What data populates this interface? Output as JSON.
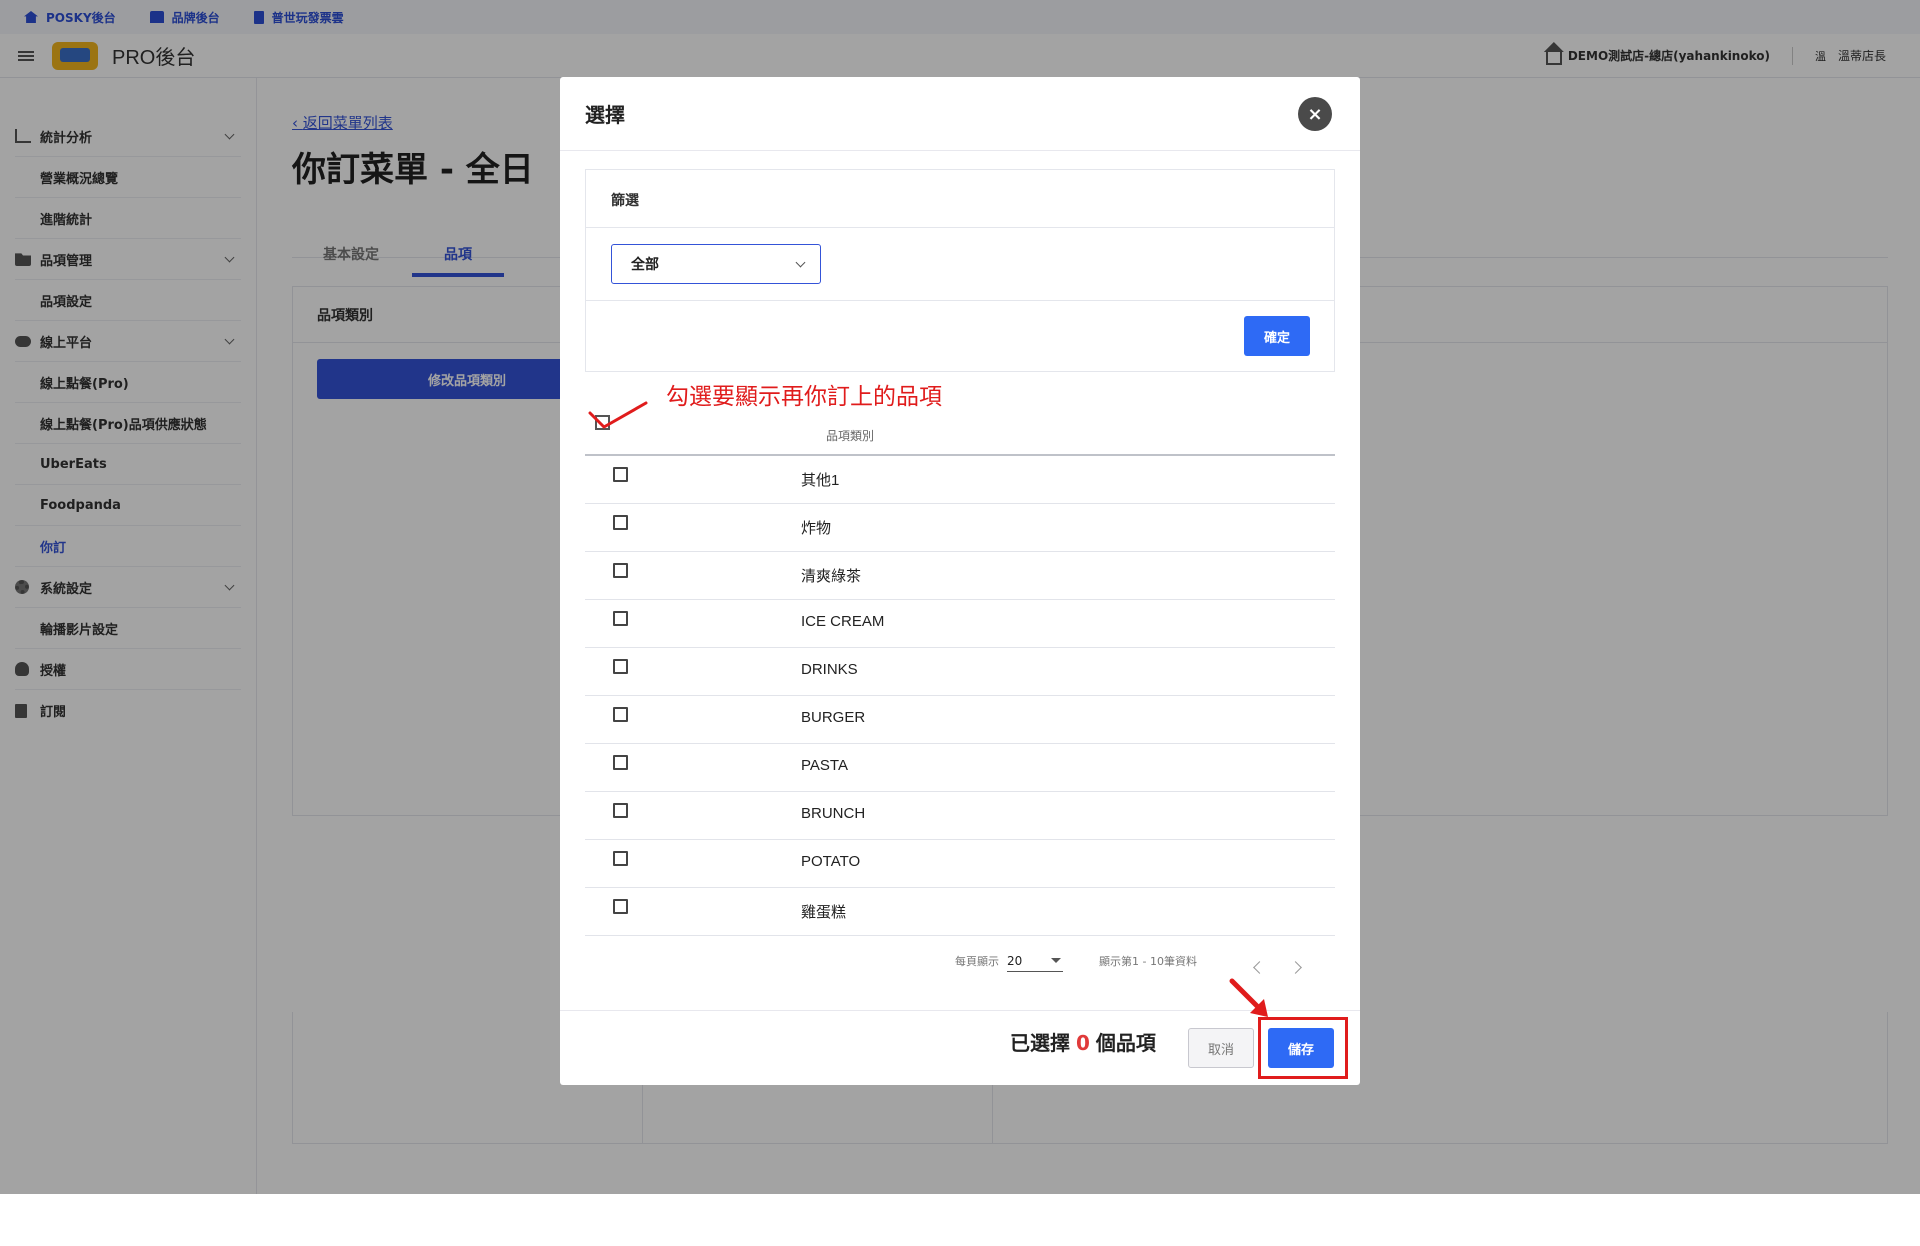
{
  "topbar": {
    "links": [
      {
        "label": "POSKY後台",
        "icon": "home-icon"
      },
      {
        "label": "品牌後台",
        "icon": "store-icon"
      },
      {
        "label": "普世玩發票雲",
        "icon": "document-icon"
      }
    ]
  },
  "header": {
    "brand": "PRO後台",
    "store": "DEMO測試店-總店(yahankinoko)",
    "avatar_char": "溫",
    "user": "溫蒂店長"
  },
  "sidebar": {
    "items": [
      {
        "label": "統計分析",
        "type": "parent",
        "icon": "chart-icon"
      },
      {
        "label": "營業概況總覽",
        "type": "child"
      },
      {
        "label": "進階統計",
        "type": "child"
      },
      {
        "label": "品項管理",
        "type": "parent",
        "icon": "folder-icon"
      },
      {
        "label": "品項設定",
        "type": "child"
      },
      {
        "label": "線上平台",
        "type": "parent",
        "icon": "cloud-icon"
      },
      {
        "label": "線上點餐(Pro)",
        "type": "child"
      },
      {
        "label": "線上點餐(Pro)品項供應狀態",
        "type": "child"
      },
      {
        "label": "UberEats",
        "type": "child"
      },
      {
        "label": "Foodpanda",
        "type": "child"
      },
      {
        "label": "你訂",
        "type": "child",
        "active": true
      },
      {
        "label": "系統設定",
        "type": "parent",
        "icon": "gear-icon"
      },
      {
        "label": "輪播影片設定",
        "type": "child"
      },
      {
        "label": "授權",
        "type": "single",
        "icon": "person-icon"
      },
      {
        "label": "訂閱",
        "type": "single",
        "icon": "document-icon"
      }
    ]
  },
  "main": {
    "back_link": "返回菜單列表",
    "page_title": "你訂菜單 - 全日",
    "tabs": [
      "基本設定",
      "品項"
    ],
    "active_tab": "品項",
    "panel_label": "品項類別",
    "edit_button": "修改品項類別"
  },
  "modal": {
    "title": "選擇",
    "close_symbol": "×",
    "filter": {
      "label": "篩選",
      "selected": "全部",
      "confirm": "確定"
    },
    "annotation": "勾選要顯示再你訂上的品項",
    "column_header": "品項類別",
    "rows": [
      "其他1",
      "炸物",
      "清爽綠茶",
      "ICE CREAM",
      "DRINKS",
      "BURGER",
      "PASTA",
      "BRUNCH",
      "POTATO",
      "雞蛋糕"
    ],
    "pager": {
      "per_page_label": "每頁顯示",
      "per_page": "20",
      "range": "顯示第1 - 10筆資料"
    },
    "footer": {
      "selected_prefix": "已選擇",
      "selected_count": "0",
      "selected_suffix": "個品項",
      "cancel": "取消",
      "save": "儲存"
    }
  },
  "colors": {
    "accent": "#2e6af5",
    "annotation": "#e01c1c"
  }
}
